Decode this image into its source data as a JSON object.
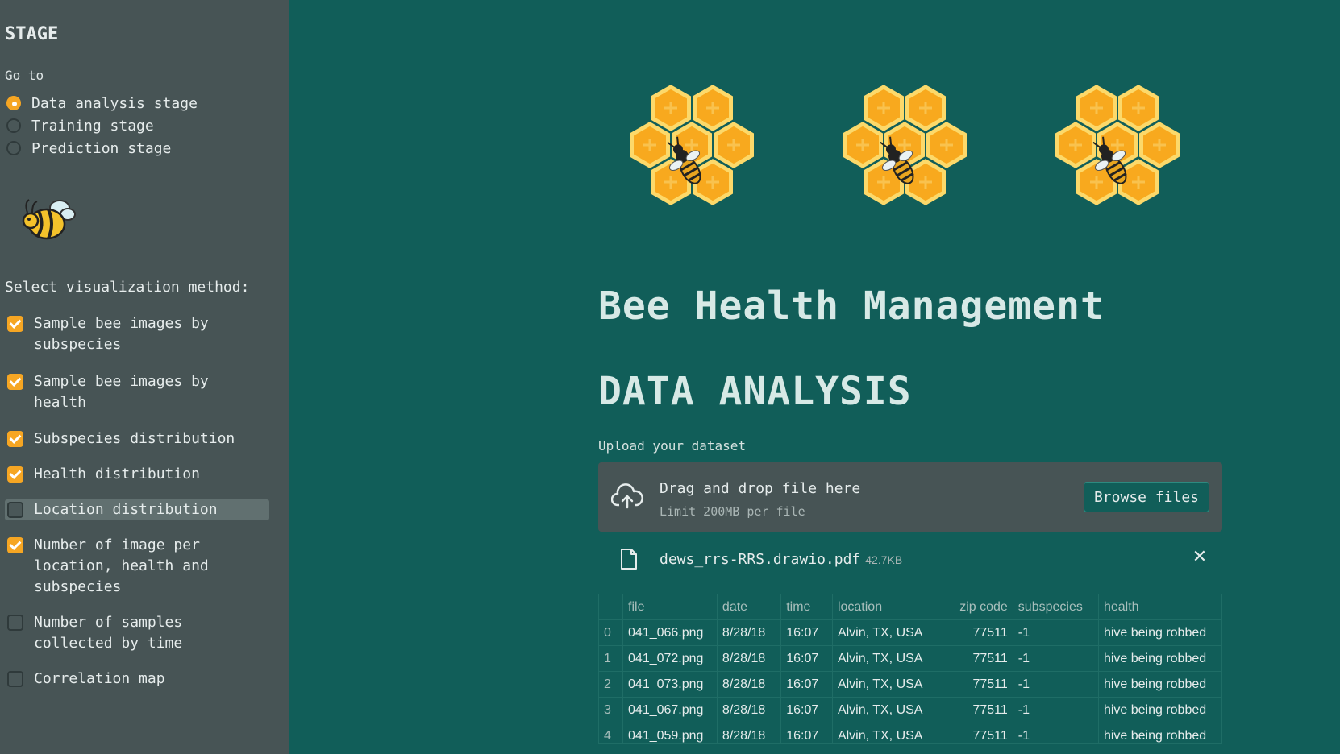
{
  "sidebar": {
    "title": "STAGE",
    "goto_label": "Go to",
    "radio_options": [
      {
        "label": "Data analysis stage",
        "selected": true
      },
      {
        "label": "Training stage",
        "selected": false
      },
      {
        "label": "Prediction stage",
        "selected": false
      }
    ],
    "logo_icon": "bee-icon",
    "select_label": "Select visualization method:",
    "checkboxes": [
      {
        "label": "Sample bee images by subspecies",
        "checked": true
      },
      {
        "label": "Sample bee images by health",
        "checked": true
      },
      {
        "label": "Subspecies distribution",
        "checked": true
      },
      {
        "label": "Health distribution",
        "checked": true
      },
      {
        "label": "Location distribution",
        "checked": false
      },
      {
        "label": "Number of image per location, health and subspecies",
        "checked": true
      },
      {
        "label": "Number of samples collected by time",
        "checked": false
      },
      {
        "label": "Correlation map",
        "checked": false
      }
    ]
  },
  "main": {
    "header_images": [
      "honeycomb-bee-icon",
      "honeycomb-bee-icon",
      "honeycomb-bee-icon"
    ],
    "title": "Bee Health Management",
    "section_title": "DATA ANALYSIS",
    "uploader": {
      "label": "Upload your dataset",
      "drag_text": "Drag and drop file here",
      "limit_text": "Limit 200MB per file",
      "browse_label": "Browse files"
    },
    "uploaded_file": {
      "name": "dews_rrs-RRS.drawio.pdf",
      "size": "42.7KB"
    },
    "table": {
      "columns": [
        "",
        "file",
        "date",
        "time",
        "location",
        "zip code",
        "subspecies",
        "health"
      ],
      "rows": [
        [
          "0",
          "041_066.png",
          "8/28/18",
          "16:07",
          "Alvin, TX, USA",
          "77511",
          "-1",
          "hive being robbed"
        ],
        [
          "1",
          "041_072.png",
          "8/28/18",
          "16:07",
          "Alvin, TX, USA",
          "77511",
          "-1",
          "hive being robbed"
        ],
        [
          "2",
          "041_073.png",
          "8/28/18",
          "16:07",
          "Alvin, TX, USA",
          "77511",
          "-1",
          "hive being robbed"
        ],
        [
          "3",
          "041_067.png",
          "8/28/18",
          "16:07",
          "Alvin, TX, USA",
          "77511",
          "-1",
          "hive being robbed"
        ],
        [
          "4",
          "041_059.png",
          "8/28/18",
          "16:07",
          "Alvin, TX, USA",
          "77511",
          "-1",
          "hive being robbed"
        ]
      ]
    }
  },
  "colors": {
    "background": "#115e59",
    "sidebar": "#475455",
    "accent": "#f6a623"
  }
}
